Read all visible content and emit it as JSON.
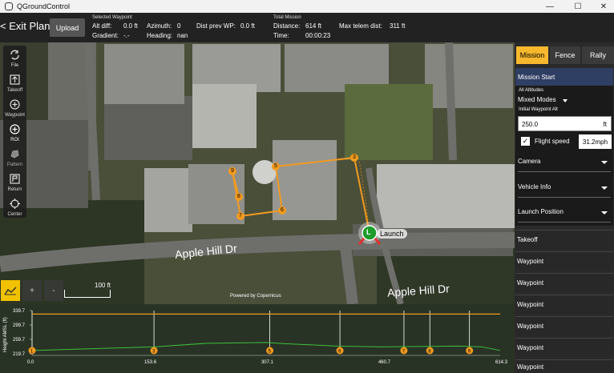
{
  "window": {
    "title": "QGroundControl",
    "minimize": "—",
    "maximize": "☐",
    "close": "✕"
  },
  "toolbar": {
    "exit_label": "< Exit Plan",
    "upload_label": "Upload",
    "selected_waypoint_title": "Selected Waypoint",
    "alt_diff": "Alt diff:",
    "alt_diff_value": "0.0 ft",
    "azimuth": "Azimuth:",
    "azimuth_value": "0",
    "dist_prev": "Dist prev WP:",
    "dist_prev_value": "0.0 ft",
    "gradient": "Gradient:",
    "gradient_value": "-.-",
    "heading": "Heading:",
    "heading_value": "nan",
    "total_mission_title": "Total Mission",
    "distance": "Distance:",
    "distance_value": "614 ft",
    "max_telem": "Max telem dist:",
    "max_telem_value": "311 ft",
    "time": "Time:",
    "time_value": "00:00:23"
  },
  "tools": [
    {
      "label": "File",
      "icon": "sync-icon"
    },
    {
      "label": "Takeoff",
      "icon": "takeoff-icon"
    },
    {
      "label": "Waypoint",
      "icon": "plus-circle-icon"
    },
    {
      "label": "ROI",
      "icon": "plus-circle-icon"
    },
    {
      "label": "Pattern",
      "icon": "pattern-icon"
    },
    {
      "label": "Return",
      "icon": "return-icon"
    },
    {
      "label": "Center",
      "icon": "crosshair-icon"
    }
  ],
  "map": {
    "road_label": "Apple Hill Dr",
    "launch_label": "Launch",
    "launch_marker": "L",
    "waypoints": [
      "3",
      "5",
      "6",
      "7",
      "8",
      "9"
    ],
    "scale_label": "100 ft",
    "copyright": "Powered by Copernicus",
    "zoom_in": "+",
    "zoom_out": "-"
  },
  "panel": {
    "tabs": [
      "Mission",
      "Fence",
      "Rally"
    ],
    "active_tab": "Mission",
    "mission_start": "Mission Start",
    "all_altitudes": "All Altitudes",
    "altitude_mode": "Mixed Modes",
    "initial_wp_alt_label": "Initial Waypoint Alt",
    "initial_wp_alt_value": "250.0",
    "initial_wp_alt_unit": "ft",
    "flight_speed_label": "Flight speed",
    "flight_speed_checked": true,
    "flight_speed_value": "31.2mph",
    "sections": [
      "Camera",
      "Vehicle Info",
      "Launch Position"
    ],
    "items": [
      "Takeoff",
      "Waypoint",
      "Waypoint",
      "Waypoint",
      "Waypoint",
      "Waypoint",
      "Waypoint"
    ]
  },
  "chart_data": {
    "type": "line",
    "ylabel": "Height AMSL (ft)",
    "y_ticks": [
      "339.7",
      "299.7",
      "259.7",
      "219.7"
    ],
    "x_ticks": [
      "0.0",
      "153.6",
      "307.1",
      "460.7",
      "614.3"
    ],
    "ylim": [
      219.7,
      339.7
    ],
    "xlim": [
      0.0,
      614.3
    ],
    "series": [
      {
        "x": [
          0,
          614.3
        ],
        "values": [
          330,
          330
        ]
      },
      {
        "x": [
          0,
          160,
          230,
          307,
          330,
          400,
          460,
          560,
          590,
          614.3
        ],
        "values": [
          229,
          239,
          249,
          251,
          248,
          241,
          239,
          241,
          239,
          229
        ]
      }
    ],
    "markers": [
      {
        "label": "1",
        "x": 0
      },
      {
        "label": "3",
        "x": 160
      },
      {
        "label": "5",
        "x": 312
      },
      {
        "label": "6",
        "x": 404
      },
      {
        "label": "7",
        "x": 488
      },
      {
        "label": "8",
        "x": 522
      },
      {
        "label": "9",
        "x": 574
      }
    ]
  }
}
